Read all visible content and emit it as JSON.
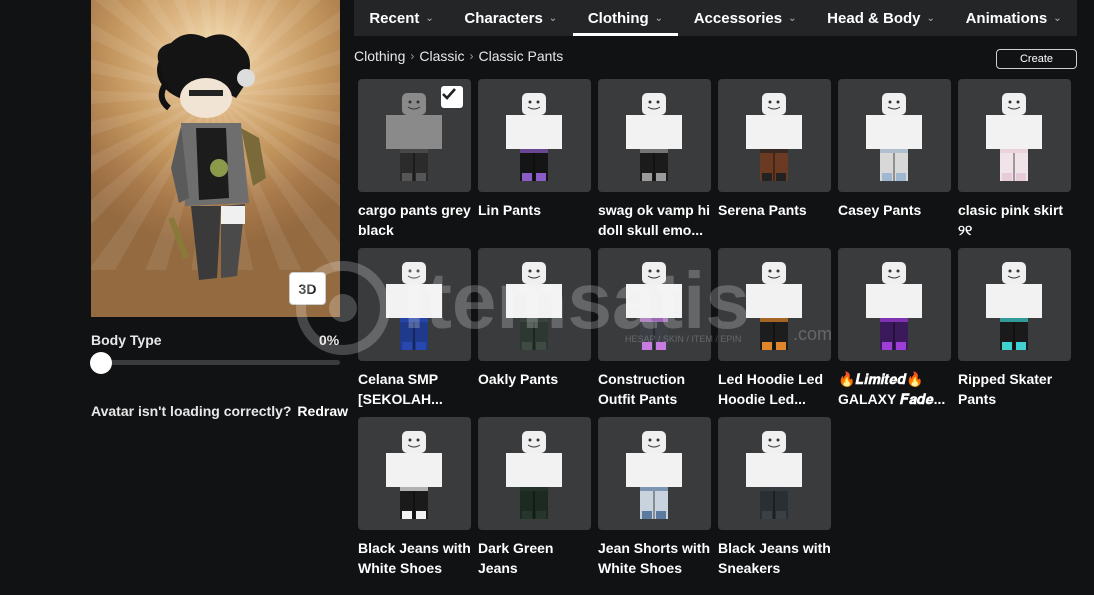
{
  "nav": {
    "tabs": [
      {
        "label": "Recent",
        "active": false
      },
      {
        "label": "Characters",
        "active": false
      },
      {
        "label": "Clothing",
        "active": true
      },
      {
        "label": "Accessories",
        "active": false
      },
      {
        "label": "Head & Body",
        "active": false
      },
      {
        "label": "Animations",
        "active": false
      }
    ]
  },
  "breadcrumb": [
    "Clothing",
    "Classic",
    "Classic Pants"
  ],
  "create_label": "Create",
  "avatar": {
    "view_toggle": "3D",
    "body_type_label": "Body Type",
    "body_type_value": "0%",
    "body_type_level": 0,
    "loading_msg": "Avatar isn't loading correctly?",
    "redraw_label": "Redraw"
  },
  "watermark": {
    "brand": "itemsatis",
    "domain": ".com",
    "tagline": "HESAP / SKIN / ITEM / EPIN"
  },
  "items": [
    {
      "name": "cargo pants grey black",
      "selected": true,
      "torso": "#8a8a8a",
      "pants": "#2b2b2b",
      "accent": "#555555"
    },
    {
      "name": "Lin Pants",
      "selected": false,
      "torso": "#f2f2f2",
      "pants": "#151515",
      "accent": "#8a5cc8"
    },
    {
      "name": "swag ok vamp hi doll skull emo...",
      "selected": false,
      "torso": "#f2f2f2",
      "pants": "#1b1b1b",
      "accent": "#9a9a9a"
    },
    {
      "name": "Serena Pants",
      "selected": false,
      "torso": "#f2f2f2",
      "pants": "#6a3a22",
      "accent": "#222222"
    },
    {
      "name": "Casey Pants",
      "selected": false,
      "torso": "#f2f2f2",
      "pants": "#d8d8d8",
      "accent": "#9fb7cf"
    },
    {
      "name": "clasic pink skirt ୨୧",
      "selected": false,
      "torso": "#f2f2f2",
      "pants": "#f0e4e8",
      "accent": "#e8cbd8"
    },
    {
      "name": "Celana SMP [SEKOLAH...",
      "selected": false,
      "torso": "#f2f2f2",
      "pants": "#1f3a8a",
      "accent": "#2848b0"
    },
    {
      "name": "Oakly Pants",
      "selected": false,
      "torso": "#f2f2f2",
      "pants": "#2e3832",
      "accent": "#3f4a44"
    },
    {
      "name": "Construction Outfit Pants",
      "selected": false,
      "torso": "#f2f2f2",
      "pants": "#3c3f46",
      "accent": "#c87be0"
    },
    {
      "name": "Led Hoodie Led Hoodie Led...",
      "selected": false,
      "torso": "#f2f2f2",
      "pants": "#1d1d1d",
      "accent": "#e0862a"
    },
    {
      "name": "🔥𝑳𝒊𝒎𝒊𝒕𝒆𝒅🔥 GALAXY 𝑭𝒂𝒅𝒆...",
      "selected": false,
      "torso": "#f2f2f2",
      "pants": "#3a1a5a",
      "accent": "#9d3fd6"
    },
    {
      "name": "Ripped Skater Pants",
      "selected": false,
      "torso": "#f2f2f2",
      "pants": "#1a1a1a",
      "accent": "#3fd0d0"
    },
    {
      "name": "Black Jeans with White Shoes",
      "selected": false,
      "torso": "#f2f2f2",
      "pants": "#1a1a1a",
      "accent": "#f2f2f2"
    },
    {
      "name": "Dark Green Jeans",
      "selected": false,
      "torso": "#f2f2f2",
      "pants": "#1c2a22",
      "accent": "#26362c"
    },
    {
      "name": "Jean Shorts with White Shoes",
      "selected": false,
      "torso": "#f2f2f2",
      "pants": "#c9d3dd",
      "accent": "#5a7aa0"
    },
    {
      "name": "Black Jeans with Sneakers",
      "selected": false,
      "torso": "#f2f2f2",
      "pants": "#2a2f33",
      "accent": "#3a4046"
    }
  ]
}
